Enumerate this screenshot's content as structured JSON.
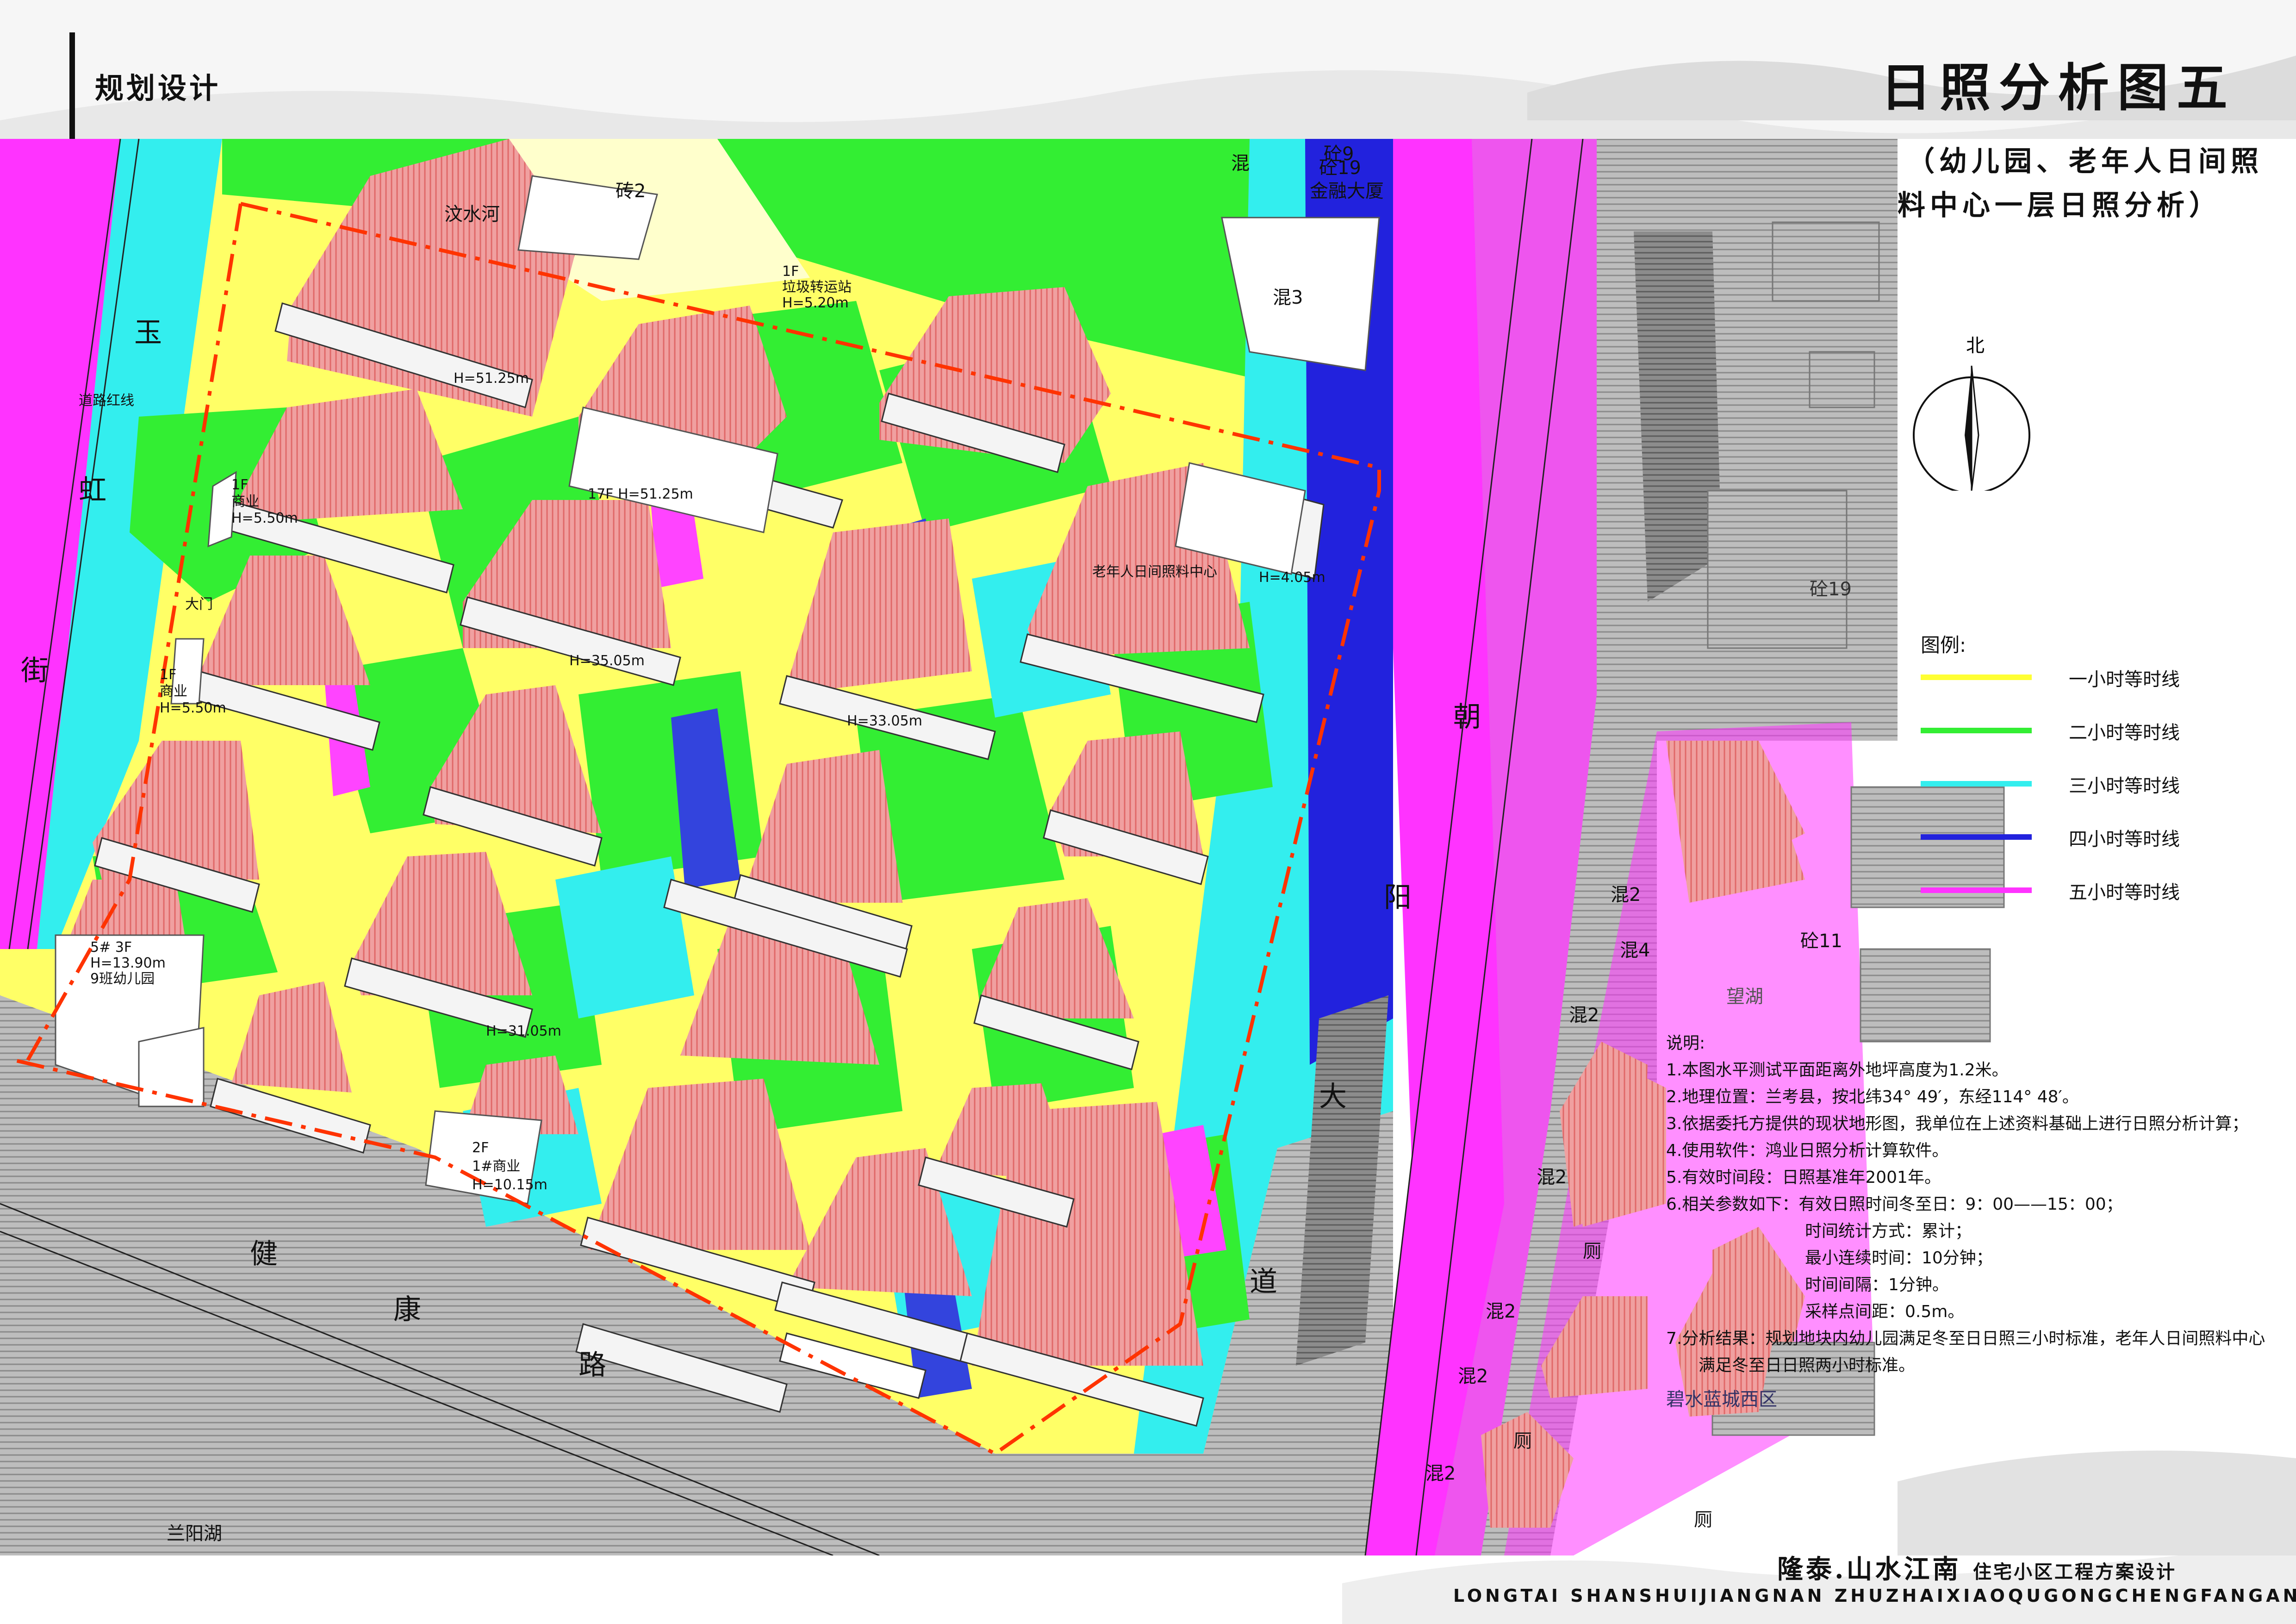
{
  "header": {
    "section": "规划设计",
    "title": "日照分析图五",
    "subtitle_line1": "（幼儿园、老年人日间照",
    "subtitle_line2": "料中心一层日照分析）"
  },
  "compass": {
    "north": "北"
  },
  "legend": {
    "title": "图例:",
    "items": [
      {
        "label": "一小时等时线",
        "color": "#ffff33"
      },
      {
        "label": "二小时等时线",
        "color": "#33ee33"
      },
      {
        "label": "三小时等时线",
        "color": "#33eeee"
      },
      {
        "label": "四小时等时线",
        "color": "#2222dd"
      },
      {
        "label": "五小时等时线",
        "color": "#ff33ff"
      }
    ]
  },
  "notes": {
    "title": "说明:",
    "lines": [
      "1.本图水平测试平面距离外地坪高度为1.2米。",
      "2.地理位置：兰考县，按北纬34° 49′，东经114° 48′。",
      "3.依据委托方提供的现状地形图，我单位在上述资料基础上进行日照分析计算；",
      "4.使用软件：鸿业日照分析计算软件。",
      "5.有效时间段：日照基准年2001年。",
      "6.相关参数如下：有效日照时间冬至日：9：00——15：00；"
    ],
    "params": [
      "时间统计方式：累计；",
      "最小连续时间：10分钟；",
      "时间间隔：1分钟。",
      "采样点间距：0.5m。"
    ],
    "result1": "7.分析结果：规划地块内幼儿园满足冬至日日照三小时标准，老年人日间照料中心",
    "result2": "满足冬至日日照两小时标准。"
  },
  "footer": {
    "brand": "隆泰.山水江南",
    "project": "住宅小区工程方案设计",
    "english": "LONGTAI SHANSHUIJIANGNAN ZHUZHAIXIAOQUGONGCHENGFANGANSHEJI"
  },
  "map_labels": {
    "road_west": [
      "玉",
      "虹",
      "街"
    ],
    "road_south": [
      "健",
      "康",
      "路"
    ],
    "road_east": [
      "朝",
      "阳",
      "大",
      "道"
    ],
    "river": "汶水河",
    "red_line": "道路红线",
    "finance": "金融大厦",
    "elderly": "老年人日间照料中心",
    "kindergarten": [
      "5# 3F",
      "H=13.90m",
      "9班幼儿园"
    ],
    "commerce_a": [
      "1F",
      "商业",
      "H=5.50m"
    ],
    "commerce_b": [
      "1F",
      "商业",
      "H=5.50m"
    ],
    "gate": "大门",
    "garbage": [
      "1F",
      "垃圾转运站",
      "H=5.20m"
    ],
    "shop_south": [
      "2F",
      "1#商业",
      "H=10.15m"
    ],
    "lanyang": "兰阳湖",
    "bishui": "碧水蓝城西区",
    "wanghu": "望湖",
    "bld_tags": [
      "混2",
      "混3",
      "混4",
      "混",
      "砼19",
      "砼9",
      "砼11",
      "砖2",
      "厕"
    ],
    "heights": [
      "17F H=51.25m",
      "H=51.25m",
      "H=35.05m",
      "H=33.05m",
      "H=31.05m",
      "H=4.05m"
    ]
  }
}
